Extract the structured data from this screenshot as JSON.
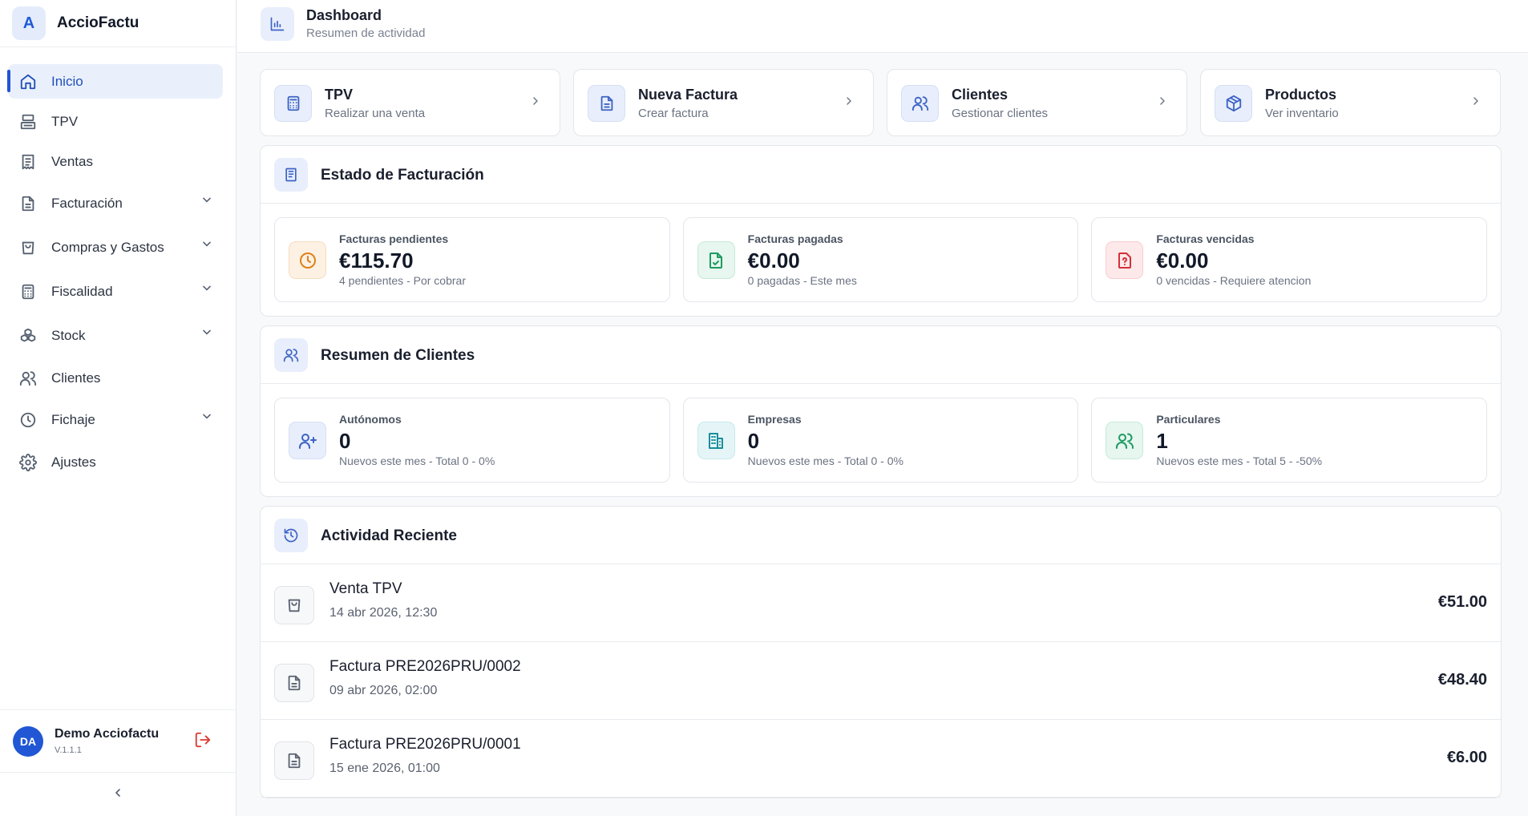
{
  "app": {
    "logo_letter": "A",
    "name": "AccioFactu"
  },
  "sidebar": {
    "items": [
      {
        "label": "Inicio",
        "icon": "home-icon"
      },
      {
        "label": "TPV",
        "icon": "register-icon"
      },
      {
        "label": "Ventas",
        "icon": "receipt-icon"
      },
      {
        "label": "Facturación",
        "icon": "document-icon"
      },
      {
        "label": "Compras y Gastos",
        "icon": "shopping-bag-icon"
      },
      {
        "label": "Fiscalidad",
        "icon": "calculator-icon"
      },
      {
        "label": "Stock",
        "icon": "boxes-icon"
      },
      {
        "label": "Clientes",
        "icon": "users-icon"
      },
      {
        "label": "Fichaje",
        "icon": "clock-icon"
      },
      {
        "label": "Ajustes",
        "icon": "gear-icon"
      }
    ]
  },
  "user": {
    "initials": "DA",
    "name": "Demo Acciofactu",
    "version": "V.1.1.1"
  },
  "header": {
    "title": "Dashboard",
    "subtitle": "Resumen de actividad"
  },
  "quick_actions": [
    {
      "title": "TPV",
      "subtitle": "Realizar una venta"
    },
    {
      "title": "Nueva Factura",
      "subtitle": "Crear factura"
    },
    {
      "title": "Clientes",
      "subtitle": "Gestionar clientes"
    },
    {
      "title": "Productos",
      "subtitle": "Ver inventario"
    }
  ],
  "billing": {
    "title": "Estado de Facturación",
    "cards": [
      {
        "label": "Facturas pendientes",
        "value": "€115.70",
        "sub": "4 pendientes - Por cobrar"
      },
      {
        "label": "Facturas pagadas",
        "value": "€0.00",
        "sub": "0 pagadas - Este mes"
      },
      {
        "label": "Facturas vencidas",
        "value": "€0.00",
        "sub": "0 vencidas - Requiere atencion"
      }
    ]
  },
  "clients": {
    "title": "Resumen de Clientes",
    "cards": [
      {
        "label": "Autónomos",
        "value": "0",
        "sub": "Nuevos este mes - Total 0 - 0%"
      },
      {
        "label": "Empresas",
        "value": "0",
        "sub": "Nuevos este mes - Total 0 - 0%"
      },
      {
        "label": "Particulares",
        "value": "1",
        "sub": "Nuevos este mes - Total 5 - -50%"
      }
    ]
  },
  "activity": {
    "title": "Actividad Reciente",
    "items": [
      {
        "title": "Venta TPV",
        "date": "14 abr 2026, 12:30",
        "amount": "€51.00"
      },
      {
        "title": "Factura PRE2026PRU/0002",
        "date": "09 abr 2026, 02:00",
        "amount": "€48.40"
      },
      {
        "title": "Factura PRE2026PRU/0001",
        "date": "15 ene 2026, 01:00",
        "amount": "€6.00"
      }
    ]
  },
  "colors": {
    "accent": "#2255d3",
    "danger": "#d9382f",
    "warning": "#dd8215",
    "success": "#1e9a62"
  }
}
